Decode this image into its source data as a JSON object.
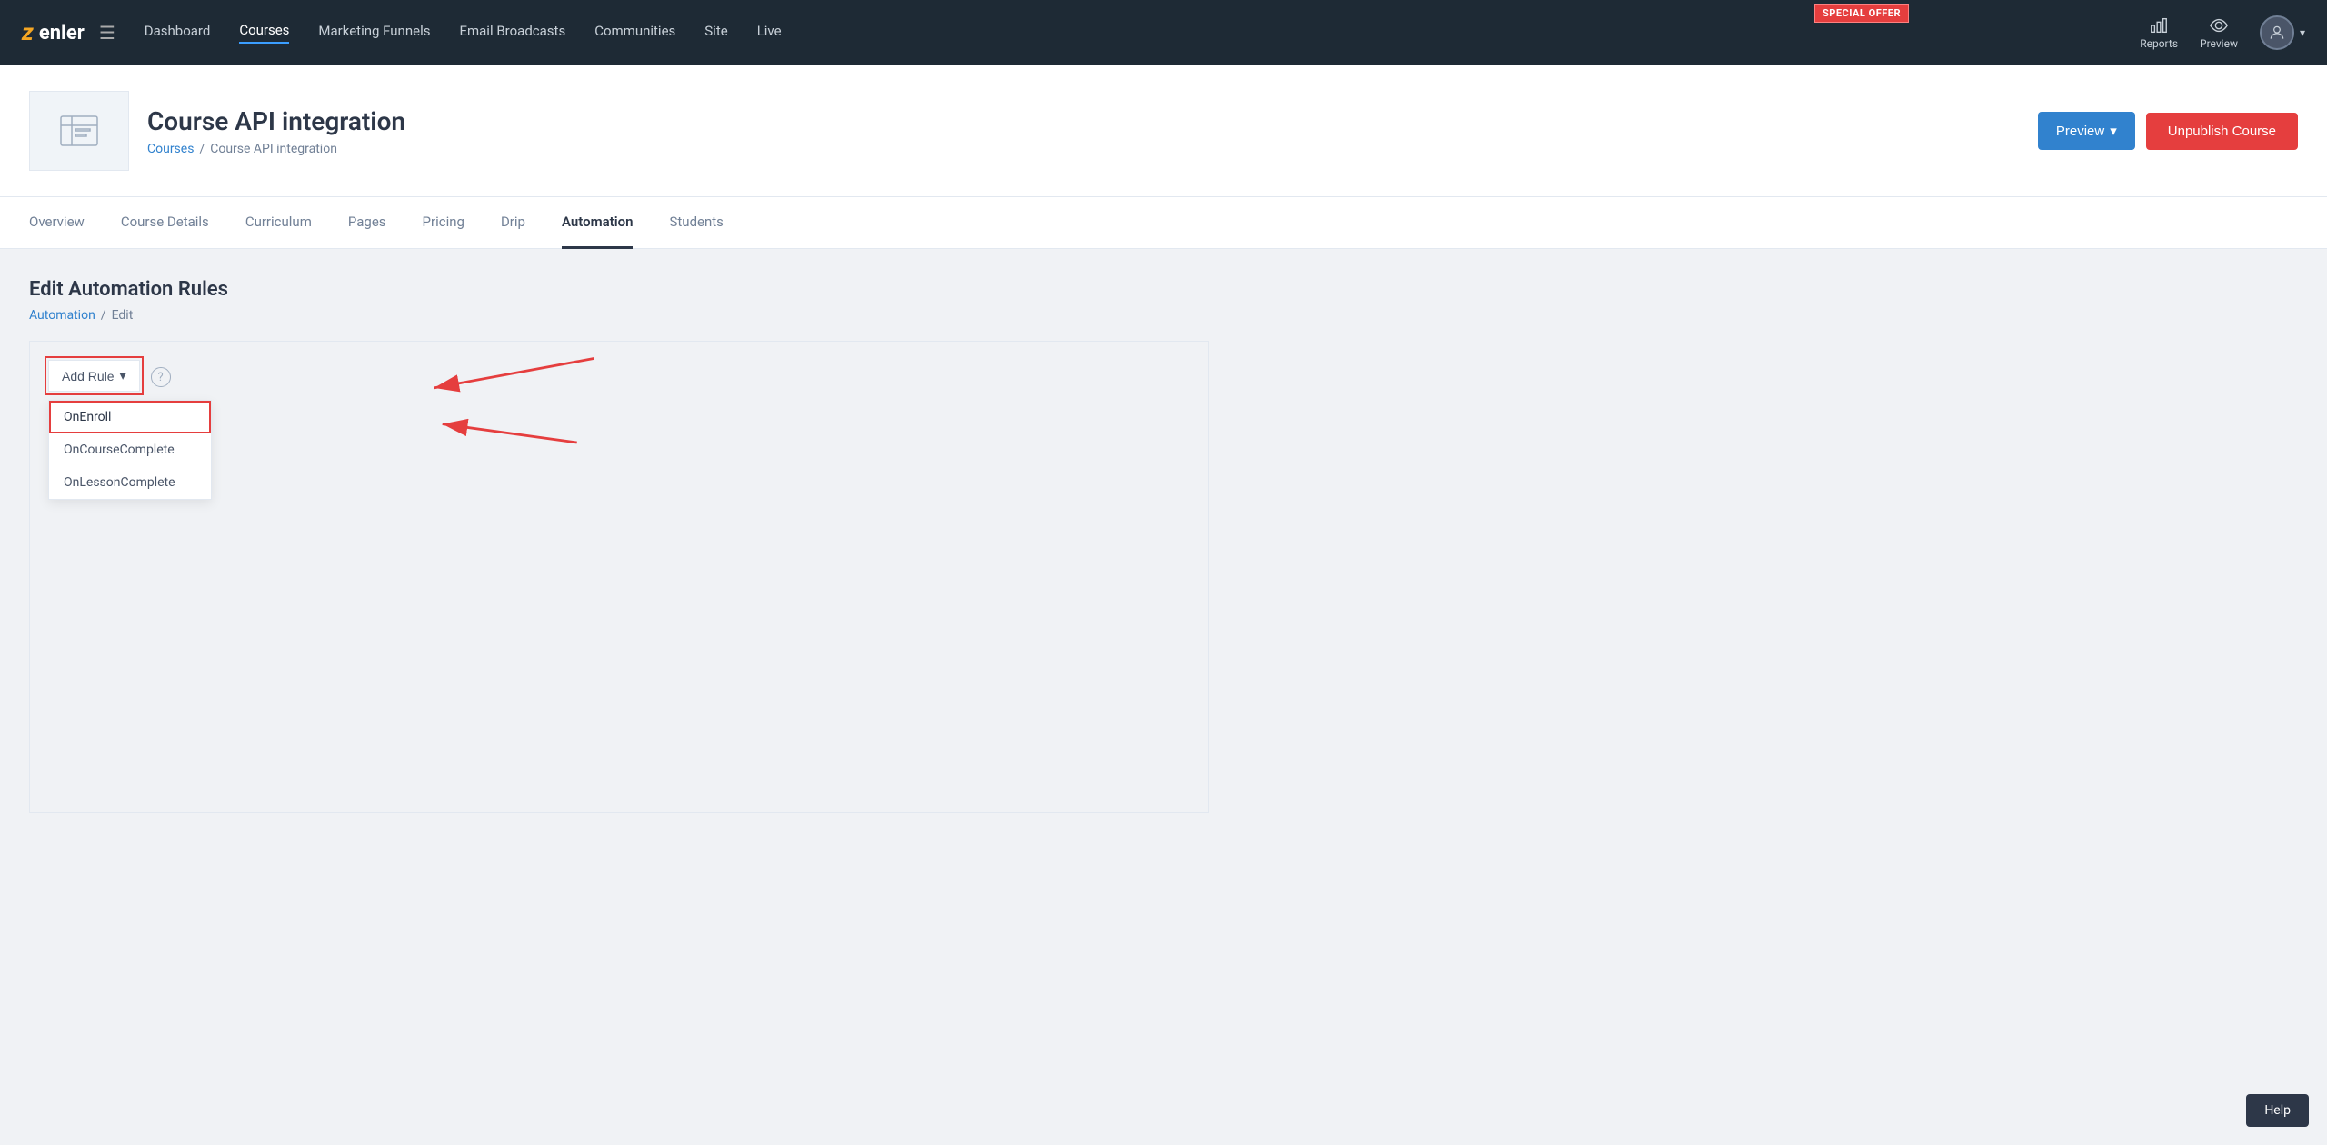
{
  "nav": {
    "logo_letter": "z",
    "logo_name": "enler",
    "links": [
      {
        "label": "Dashboard",
        "active": false
      },
      {
        "label": "Courses",
        "active": true
      },
      {
        "label": "Marketing Funnels",
        "active": false
      },
      {
        "label": "Email Broadcasts",
        "active": false
      },
      {
        "label": "Communities",
        "active": false
      },
      {
        "label": "Site",
        "active": false
      },
      {
        "label": "Live",
        "active": false
      }
    ],
    "special_offer": "SPECIAL OFFER",
    "reports_label": "Reports",
    "preview_label": "Preview"
  },
  "course_header": {
    "title": "Course API integration",
    "breadcrumb_courses": "Courses",
    "breadcrumb_separator": "/",
    "breadcrumb_current": "Course API integration",
    "btn_preview": "Preview",
    "btn_unpublish": "Unpublish Course"
  },
  "tabs": [
    {
      "label": "Overview",
      "active": false
    },
    {
      "label": "Course Details",
      "active": false
    },
    {
      "label": "Curriculum",
      "active": false
    },
    {
      "label": "Pages",
      "active": false
    },
    {
      "label": "Pricing",
      "active": false
    },
    {
      "label": "Drip",
      "active": false
    },
    {
      "label": "Automation",
      "active": true
    },
    {
      "label": "Students",
      "active": false
    }
  ],
  "automation": {
    "section_title": "Edit Automation Rules",
    "breadcrumb_automation": "Automation",
    "breadcrumb_separator": "/",
    "breadcrumb_edit": "Edit",
    "add_rule_label": "Add Rule",
    "dropdown_items": [
      {
        "label": "OnEnroll",
        "highlighted": true
      },
      {
        "label": "OnCourseComplete",
        "highlighted": false
      },
      {
        "label": "OnLessonComplete",
        "highlighted": false
      }
    ]
  },
  "help_button": "Help"
}
